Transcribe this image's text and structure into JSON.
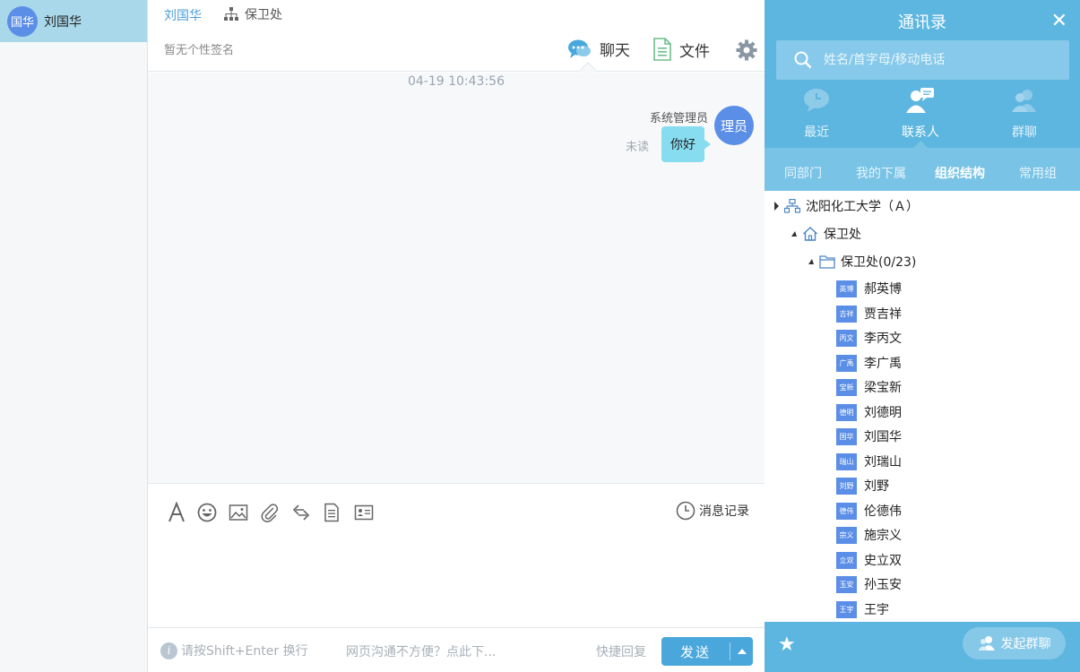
{
  "conversations": [
    {
      "avatar_text": "国华",
      "name": "刘国华"
    }
  ],
  "chat": {
    "contact_name": "刘国华",
    "department": "保卫处",
    "signature": "暂无个性签名",
    "tabs": {
      "chat": "聊天",
      "file": "文件"
    },
    "timestamp": "04-19 10:43:56",
    "message": {
      "sender": "系统管理员",
      "avatar_text": "理员",
      "text": "你好",
      "status": "未读"
    },
    "history_label": "消息记录",
    "hint": "请按Shift+Enter 换行",
    "web_hint": "网页沟通不方便？点此下...",
    "quick_reply": "快捷回复",
    "send_label": "发送"
  },
  "contacts": {
    "title": "通讯录",
    "close": "✕",
    "search_placeholder": "姓名/首字母/移动电话",
    "tabs": {
      "recent": "最近",
      "contacts": "联系人",
      "groups": "群聊"
    },
    "subtabs": {
      "dept": "同部门",
      "subordinates": "我的下属",
      "org": "组织结构",
      "common": "常用组"
    },
    "tree": {
      "org": "沈阳化工大学（Ａ）",
      "dept": "保卫处",
      "group": "保卫处(0/23)"
    },
    "people": [
      {
        "name": "郝英博",
        "ava": "英博"
      },
      {
        "name": "贾吉祥",
        "ava": "吉祥"
      },
      {
        "name": "李丙文",
        "ava": "丙文"
      },
      {
        "name": "李广禹",
        "ava": "广禹"
      },
      {
        "name": "梁宝新",
        "ava": "宝新"
      },
      {
        "name": "刘德明",
        "ava": "德明"
      },
      {
        "name": "刘国华",
        "ava": "国华"
      },
      {
        "name": "刘瑞山",
        "ava": "瑞山"
      },
      {
        "name": "刘野",
        "ava": "刘野"
      },
      {
        "name": "伦德伟",
        "ava": "德伟"
      },
      {
        "name": "施宗义",
        "ava": "宗义"
      },
      {
        "name": "史立双",
        "ava": "立双"
      },
      {
        "name": "孙玉安",
        "ava": "玉安"
      },
      {
        "name": "王宇",
        "ava": "王宇"
      }
    ],
    "start_group_label": "发起群聊"
  }
}
